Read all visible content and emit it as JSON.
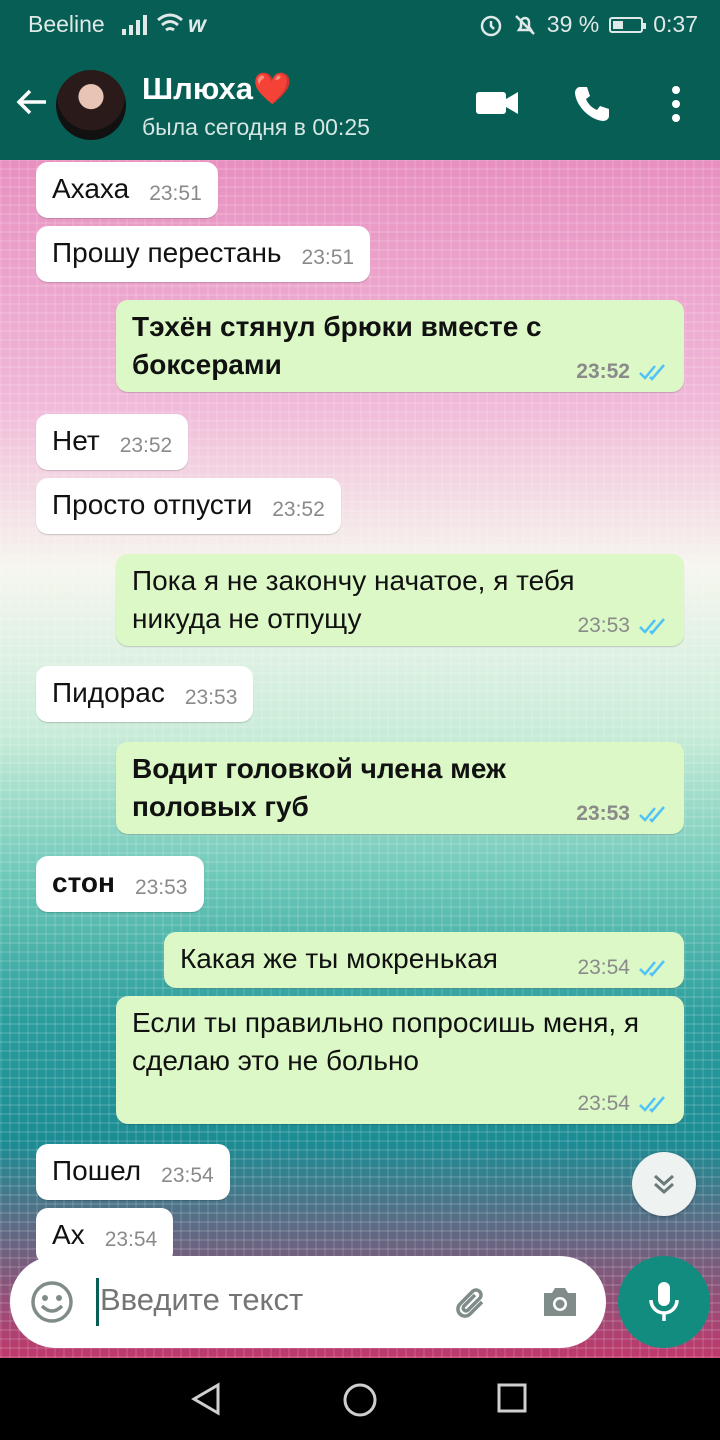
{
  "status_bar": {
    "carrier": "Beeline",
    "battery": "39 %",
    "battery_level": 0.39,
    "time": "0:37"
  },
  "header": {
    "contact_name": "Шлюха",
    "name_emoji": "❤️",
    "last_seen": "была сегодня в 00:25"
  },
  "messages": [
    {
      "dir": "in",
      "text": "Ахаха",
      "time": "23:51",
      "bold": false
    },
    {
      "dir": "in",
      "text": "Прошу перестань",
      "time": "23:51",
      "bold": false
    },
    {
      "dir": "out",
      "text": "Тэхён стянул брюки вместе с боксерами",
      "time": "23:52",
      "bold": true,
      "read": true
    },
    {
      "dir": "in",
      "text": "Нет",
      "time": "23:52",
      "bold": false
    },
    {
      "dir": "in",
      "text": "Просто отпусти",
      "time": "23:52",
      "bold": false
    },
    {
      "dir": "out",
      "text": "Пока я не закончу начатое, я тебя никуда не отпущу",
      "time": "23:53",
      "bold": false,
      "read": true
    },
    {
      "dir": "in",
      "text": "Пидорас",
      "time": "23:53",
      "bold": false
    },
    {
      "dir": "out",
      "text": "Водит головкой члена меж половых губ",
      "time": "23:53",
      "bold": true,
      "read": true
    },
    {
      "dir": "in",
      "text": "стон",
      "time": "23:53",
      "bold": true
    },
    {
      "dir": "out",
      "text": "Какая же ты мокренькая",
      "time": "23:54",
      "bold": false,
      "read": true
    },
    {
      "dir": "out",
      "text": "Если ты правильно попросишь меня, я сделаю это не больно",
      "time": "23:54",
      "bold": false,
      "read": true
    },
    {
      "dir": "in",
      "text": "Пошел",
      "time": "23:54",
      "bold": false
    },
    {
      "dir": "in",
      "text": "Ах",
      "time": "23:54",
      "bold": false
    }
  ],
  "composer": {
    "placeholder": "Введите текст"
  },
  "icons": {
    "back": "arrow-left-icon",
    "video": "video-call-icon",
    "call": "phone-icon",
    "menu": "more-vert-icon",
    "emoji": "emoji-icon",
    "attach": "paperclip-icon",
    "camera": "camera-icon",
    "mic": "mic-icon",
    "scroll": "chevron-double-down-icon",
    "read": "double-check-icon"
  },
  "colors": {
    "header": "#075e54",
    "outgoing": "#dcf8c6",
    "incoming": "#ffffff",
    "mic": "#128c7e",
    "read_check": "#4fc3f7"
  }
}
